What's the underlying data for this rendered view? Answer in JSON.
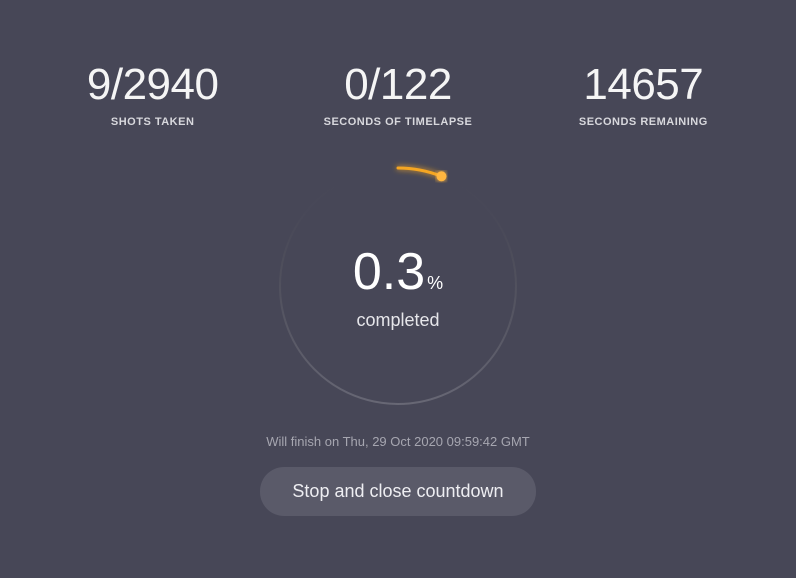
{
  "stats": {
    "shots": {
      "value": "9/2940",
      "label": "SHOTS TAKEN"
    },
    "seconds_timelapse": {
      "value": "0/122",
      "label": "SECONDS OF TIMELAPSE"
    },
    "seconds_remaining": {
      "value": "14657",
      "label": "SECONDS REMAINING"
    }
  },
  "progress": {
    "percent_value": "0.3",
    "percent_sign": "%",
    "label": "completed",
    "fraction": 0.003
  },
  "finish_text": "Will finish on Thu, 29 Oct 2020 09:59:42 GMT",
  "stop_button": "Stop and close countdown",
  "colors": {
    "accent": "#f5a623",
    "accent_glow": "#ffb640",
    "track": "#5c5c69"
  }
}
